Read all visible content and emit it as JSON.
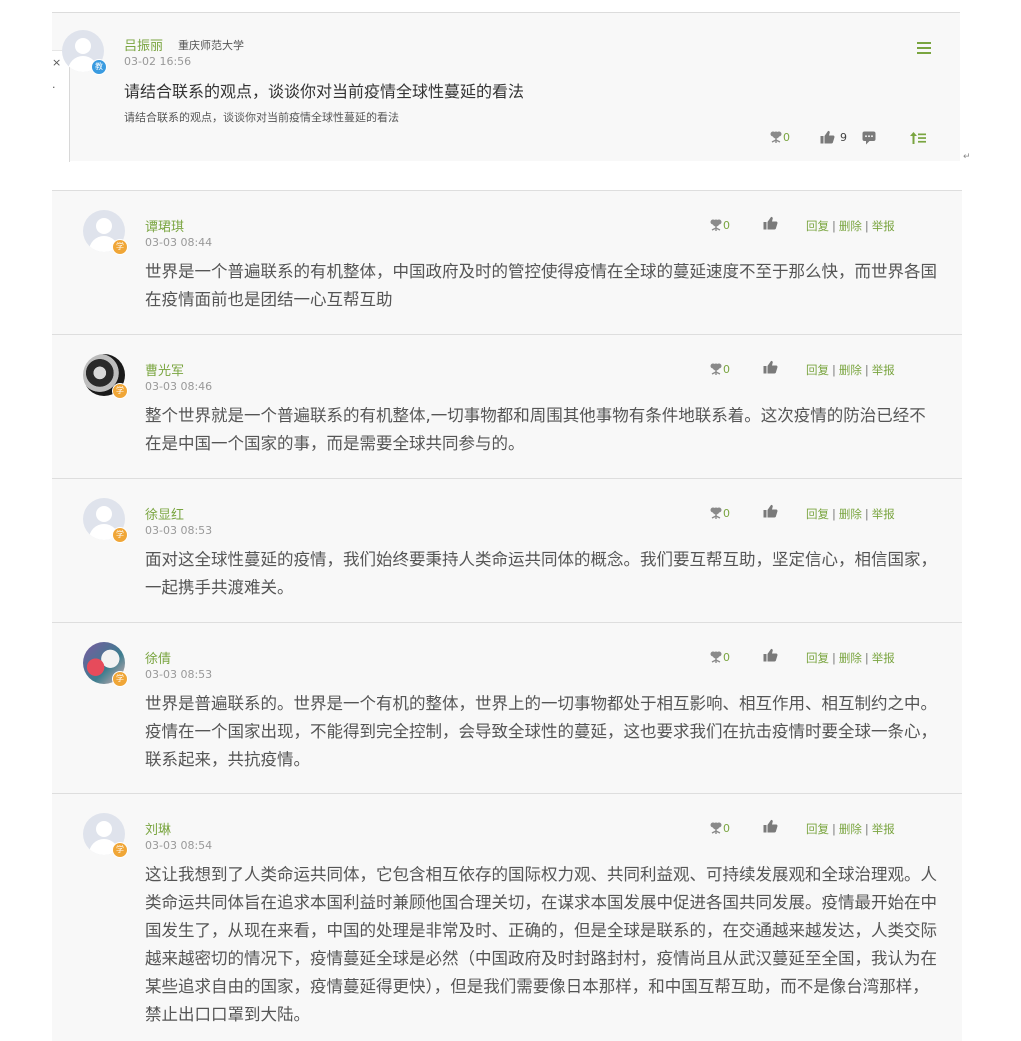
{
  "post": {
    "author": "吕振丽",
    "school": "重庆师范大学",
    "role_badge": "教",
    "time": "03-02 16:56",
    "title": "请结合联系的观点，谈谈你对当前疫情全球性蔓延的看法",
    "body": "请结合联系的观点，谈谈你对当前疫情全球性蔓延的看法",
    "flowers": "0",
    "likes": "9",
    "icons": [
      "menu-icon",
      "flower-icon",
      "thumbs-up-icon",
      "comment-icon",
      "sort-icon"
    ]
  },
  "popup": {
    "close": "×",
    "dot": "·"
  },
  "reply_actions": {
    "reply": "回复",
    "delete": "删除",
    "report": "举报",
    "sep": "|"
  },
  "replies": [
    {
      "author": "谭珺琪",
      "badge": "学",
      "time": "03-03 08:44",
      "flowers": "0",
      "text": "世界是一个普遍联系的有机整体，中国政府及时的管控使得疫情在全球的蔓延速度不至于那么快，而世界各国在疫情面前也是团结一心互帮互助"
    },
    {
      "author": "曹光军",
      "badge": "学",
      "time": "03-03 08:46",
      "flowers": "0",
      "text": "整个世界就是一个普遍联系的有机整体,一切事物都和周围其他事物有条件地联系着。这次疫情的防治已经不在是中国一个国家的事，而是需要全球共同参与的。"
    },
    {
      "author": "徐显红",
      "badge": "学",
      "time": "03-03 08:53",
      "flowers": "0",
      "text": "面对这全球性蔓延的疫情，我们始终要秉持人类命运共同体的概念。我们要互帮互助，坚定信心，相信国家，一起携手共渡难关。"
    },
    {
      "author": "徐倩",
      "badge": "学",
      "time": "03-03 08:53",
      "flowers": "0",
      "text": "世界是普遍联系的。世界是一个有机的整体，世界上的一切事物都处于相互影响、相互作用、相互制约之中。疫情在一个国家出现，不能得到完全控制，会导致全球性的蔓延，这也要求我们在抗击疫情时要全球一条心，联系起来，共抗疫情。"
    },
    {
      "author": "刘琳",
      "badge": "学",
      "time": "03-03 08:54",
      "flowers": "0",
      "text": "这让我想到了人类命运共同体，它包含相互依存的国际权力观、共同利益观、可持续发展观和全球治理观。人类命运共同体旨在追求本国利益时兼顾他国合理关切，在谋求本国发展中促进各国共同发展。疫情最开始在中国发生了，从现在来看，中国的处理是非常及时、正确的，但是全球是联系的，在交通越来越发达，人类交际越来越密切的情况下，疫情蔓延全球是必然（中国政府及时封路封村，疫情尚且从武汉蔓延至全国，我认为在某些追求自由的国家，疫情蔓延得更快），但是我们需要像日本那样，和中国互帮互助，而不是像台湾那样，禁止出口口罩到大陆。"
    }
  ]
}
